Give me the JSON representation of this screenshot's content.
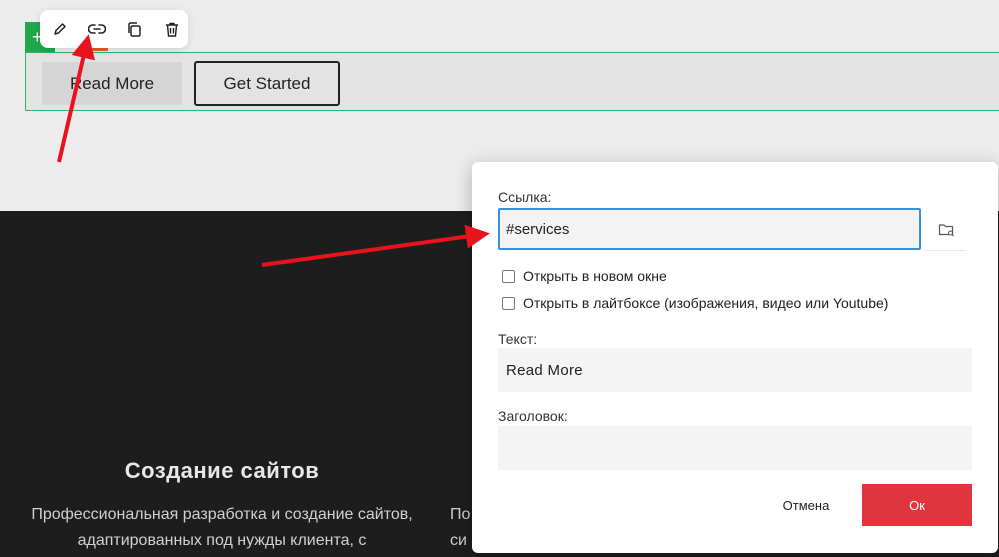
{
  "canvas": {
    "buttons": {
      "read_more": "Read More",
      "get_started": "Get Started"
    },
    "add_symbol": "+"
  },
  "toolbar": {
    "icons": [
      "pencil-icon",
      "link-icon",
      "duplicate-icon",
      "trash-icon"
    ]
  },
  "services": {
    "title": "Создание сайтов",
    "description": "Профессиональная разработка и создание сайтов, адаптированных под нужды клиента, с",
    "second_description": "По сист"
  },
  "dialog": {
    "link_label": "Ссылка:",
    "link_value": "#services",
    "open_new_window": "Открыть в новом окне",
    "open_lightbox": "Открыть в лайтбоксе (изображения, видео или Youtube)",
    "text_label": "Текст:",
    "text_value": "Read More",
    "title_label": "Заголовок:",
    "title_value": "",
    "cancel_label": "Отмена",
    "ok_label": "Ок"
  },
  "colors": {
    "accent_red": "#e0353e",
    "focus_blue": "#3b8fd9",
    "selection_green": "#31b36a",
    "annotation_red": "#e8131b"
  }
}
